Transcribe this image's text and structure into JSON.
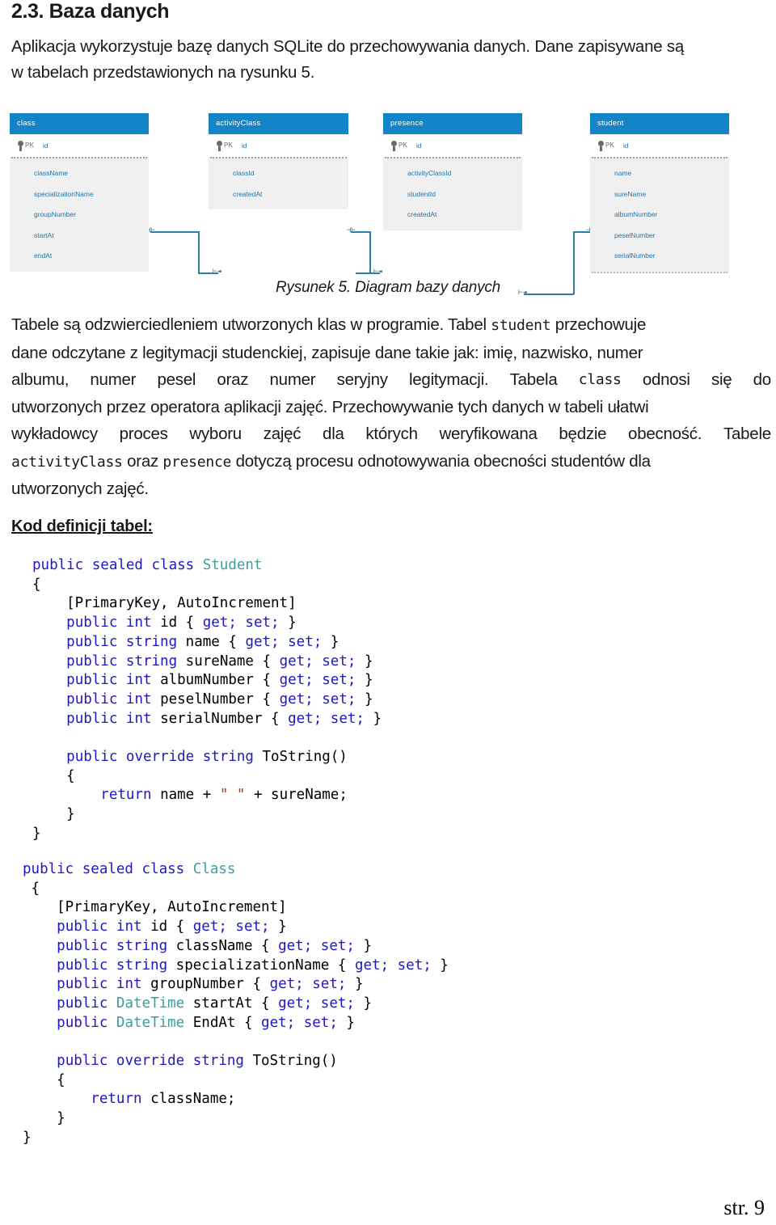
{
  "document": {
    "section_number": "2.3.",
    "section_title": "2.3. Baza danych",
    "footer_page": "str. 9"
  },
  "intro": {
    "line1": "Aplikacja wykorzystuje bazę danych SQLite do przechowywania danych. Dane zapisywane są",
    "line2": "w tabelach przedstawionych na rysunku 5."
  },
  "figure": {
    "caption": "Rysunek 5. Diagram bazy danych",
    "header_color": "#1385C6",
    "body_color": "#f0f0f0",
    "field_color": "#2176ae",
    "connector_color": "#2e7fa8",
    "pk_label": "PK",
    "pk_field": "id",
    "tables": [
      {
        "name": "class",
        "pk": "id",
        "fields": [
          "className",
          "specializationName",
          "groupNumber",
          "startAt",
          "endAt"
        ]
      },
      {
        "name": "activityClass",
        "pk": "id",
        "fields": [
          "classId",
          "createdAt"
        ]
      },
      {
        "name": "presence",
        "pk": "id",
        "fields": [
          "activityClassId",
          "studentId",
          "createdAt"
        ]
      },
      {
        "name": "student",
        "pk": "id",
        "fields": [
          "name",
          "sureName",
          "albumNumber",
          "peselNumber",
          "serialNumber"
        ]
      }
    ]
  },
  "body": {
    "l1a": "Tabele są odzwierciedleniem utworzonych klas w programie. Tabel ",
    "l1b": "student",
    "l1c": " przechowuje",
    "l2": "dane odczytane z legitymacji studenckiej, zapisuje dane takie jak: imię, nazwisko, numer",
    "l3a": "albumu,",
    "l3b": "numer",
    "l3c": "pesel",
    "l3d": "oraz",
    "l3e": "numer",
    "l3f": "seryjny",
    "l3g": "legitymacji.",
    "l3h": "Tabela",
    "l3i": "class",
    "l3j": "odnosi",
    "l3k": "się",
    "l3l": "do",
    "l4": "utworzonych przez operatora aplikacji zajęć. Przechowywanie tych danych w tabeli  ułatwi",
    "l5a": "wykładowcy",
    "l5b": "proces",
    "l5c": "wyboru",
    "l5d": "zajęć",
    "l5e": "dla",
    "l5f": "których",
    "l5g": "weryfikowana",
    "l5h": "będzie",
    "l5i": "obecność.",
    "l5j": "Tabele",
    "l6a": "activityClass",
    "l6b": " oraz ",
    "l6c": "presence",
    "l6d": " dotyczą procesu odnotowywania obecności studentów dla",
    "l7": "utworzonych zajęć."
  },
  "code": {
    "heading": "Kod definicji tabel:",
    "lines": [
      [
        {
          "t": "public sealed class ",
          "c": "kw"
        },
        {
          "t": "Student",
          "c": "typ"
        }
      ],
      [
        {
          "t": "{",
          "c": "pln"
        }
      ],
      [
        {
          "t": "    [PrimaryKey, AutoIncrement]",
          "c": "pln"
        }
      ],
      [
        {
          "t": "    ",
          "c": "pln"
        },
        {
          "t": "public int ",
          "c": "kw"
        },
        {
          "t": "id { ",
          "c": "pln"
        },
        {
          "t": "get; set;",
          "c": "kw"
        },
        {
          "t": " }",
          "c": "pln"
        }
      ],
      [
        {
          "t": "    ",
          "c": "pln"
        },
        {
          "t": "public string ",
          "c": "kw"
        },
        {
          "t": "name { ",
          "c": "pln"
        },
        {
          "t": "get; set;",
          "c": "kw"
        },
        {
          "t": " }",
          "c": "pln"
        }
      ],
      [
        {
          "t": "    ",
          "c": "pln"
        },
        {
          "t": "public string ",
          "c": "kw"
        },
        {
          "t": "sureName { ",
          "c": "pln"
        },
        {
          "t": "get; set;",
          "c": "kw"
        },
        {
          "t": " }",
          "c": "pln"
        }
      ],
      [
        {
          "t": "    ",
          "c": "pln"
        },
        {
          "t": "public int ",
          "c": "kw"
        },
        {
          "t": "albumNumber { ",
          "c": "pln"
        },
        {
          "t": "get; set;",
          "c": "kw"
        },
        {
          "t": " }",
          "c": "pln"
        }
      ],
      [
        {
          "t": "    ",
          "c": "pln"
        },
        {
          "t": "public int ",
          "c": "kw"
        },
        {
          "t": "peselNumber { ",
          "c": "pln"
        },
        {
          "t": "get; set;",
          "c": "kw"
        },
        {
          "t": " }",
          "c": "pln"
        }
      ],
      [
        {
          "t": "    ",
          "c": "pln"
        },
        {
          "t": "public int ",
          "c": "kw"
        },
        {
          "t": "serialNumber { ",
          "c": "pln"
        },
        {
          "t": "get; set;",
          "c": "kw"
        },
        {
          "t": " }",
          "c": "pln"
        }
      ],
      [
        {
          "t": "",
          "c": "pln"
        }
      ],
      [
        {
          "t": "    ",
          "c": "pln"
        },
        {
          "t": "public override string ",
          "c": "kw"
        },
        {
          "t": "ToString()",
          "c": "pln"
        }
      ],
      [
        {
          "t": "    {",
          "c": "pln"
        }
      ],
      [
        {
          "t": "        ",
          "c": "pln"
        },
        {
          "t": "return ",
          "c": "kw"
        },
        {
          "t": "name + ",
          "c": "pln"
        },
        {
          "t": "\" \"",
          "c": "str"
        },
        {
          "t": " + sureName;",
          "c": "pln"
        }
      ],
      [
        {
          "t": "    }",
          "c": "pln"
        }
      ],
      [
        {
          "t": "}",
          "c": "pln"
        }
      ]
    ],
    "lines2": [
      [
        {
          "t": "public sealed class ",
          "c": "kw"
        },
        {
          "t": "Class",
          "c": "typ"
        }
      ],
      [
        {
          "t": " {",
          "c": "pln"
        }
      ],
      [
        {
          "t": "    [PrimaryKey, AutoIncrement]",
          "c": "pln"
        }
      ],
      [
        {
          "t": "    ",
          "c": "pln"
        },
        {
          "t": "public int ",
          "c": "kw"
        },
        {
          "t": "id { ",
          "c": "pln"
        },
        {
          "t": "get; set;",
          "c": "kw"
        },
        {
          "t": " }",
          "c": "pln"
        }
      ],
      [
        {
          "t": "    ",
          "c": "pln"
        },
        {
          "t": "public string ",
          "c": "kw"
        },
        {
          "t": "className { ",
          "c": "pln"
        },
        {
          "t": "get; set;",
          "c": "kw"
        },
        {
          "t": " }",
          "c": "pln"
        }
      ],
      [
        {
          "t": "    ",
          "c": "pln"
        },
        {
          "t": "public string ",
          "c": "kw"
        },
        {
          "t": "specializationName { ",
          "c": "pln"
        },
        {
          "t": "get; set;",
          "c": "kw"
        },
        {
          "t": " }",
          "c": "pln"
        }
      ],
      [
        {
          "t": "    ",
          "c": "pln"
        },
        {
          "t": "public int ",
          "c": "kw"
        },
        {
          "t": "groupNumber { ",
          "c": "pln"
        },
        {
          "t": "get; set;",
          "c": "kw"
        },
        {
          "t": " }",
          "c": "pln"
        }
      ],
      [
        {
          "t": "    ",
          "c": "pln"
        },
        {
          "t": "public ",
          "c": "kw"
        },
        {
          "t": "DateTime",
          "c": "typ"
        },
        {
          "t": " startAt { ",
          "c": "pln"
        },
        {
          "t": "get; set;",
          "c": "kw"
        },
        {
          "t": " }",
          "c": "pln"
        }
      ],
      [
        {
          "t": "    ",
          "c": "pln"
        },
        {
          "t": "public ",
          "c": "kw"
        },
        {
          "t": "DateTime",
          "c": "typ"
        },
        {
          "t": " EndAt { ",
          "c": "pln"
        },
        {
          "t": "get; set;",
          "c": "kw"
        },
        {
          "t": " }",
          "c": "pln"
        }
      ],
      [
        {
          "t": "",
          "c": "pln"
        }
      ],
      [
        {
          "t": "    ",
          "c": "pln"
        },
        {
          "t": "public override string ",
          "c": "kw"
        },
        {
          "t": "ToString()",
          "c": "pln"
        }
      ],
      [
        {
          "t": "    {",
          "c": "pln"
        }
      ],
      [
        {
          "t": "        ",
          "c": "pln"
        },
        {
          "t": "return ",
          "c": "kw"
        },
        {
          "t": "className;",
          "c": "pln"
        }
      ],
      [
        {
          "t": "    }",
          "c": "pln"
        }
      ],
      [
        {
          "t": "}",
          "c": "pln"
        }
      ]
    ]
  }
}
